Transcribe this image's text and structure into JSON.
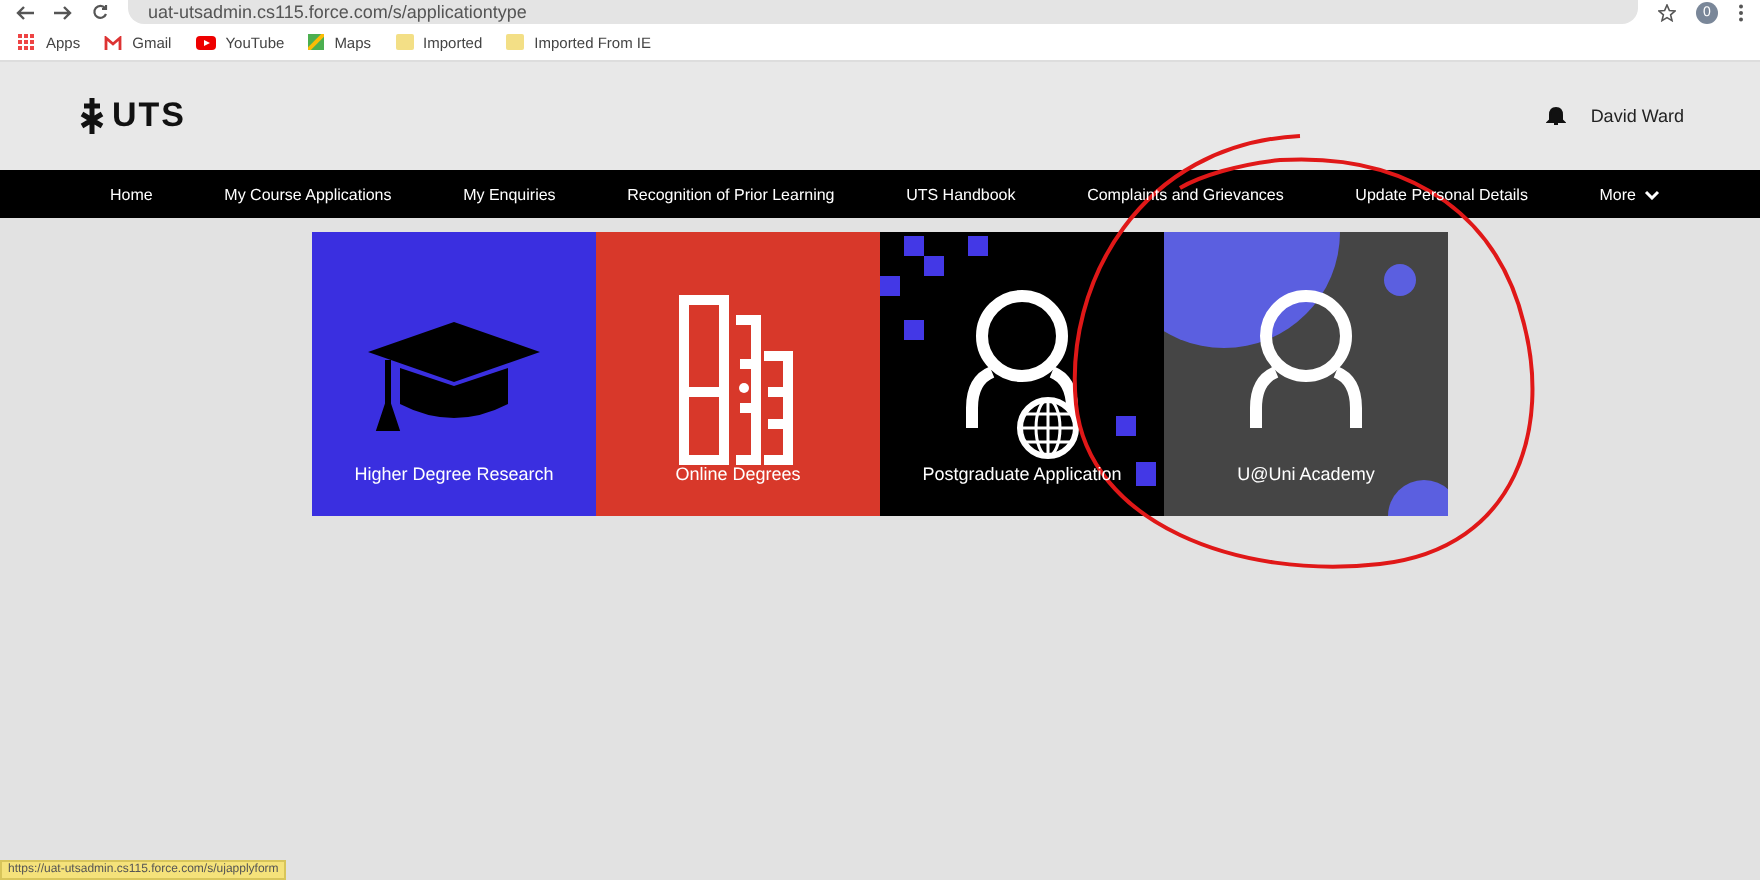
{
  "browser": {
    "url": "uat-utsadmin.cs115.force.com/s/applicationtype",
    "profile": "0",
    "bookmarks": [
      {
        "kind": "apps",
        "label": "Apps"
      },
      {
        "kind": "gmail",
        "label": "Gmail"
      },
      {
        "kind": "youtube",
        "label": "YouTube"
      },
      {
        "kind": "maps",
        "label": "Maps"
      },
      {
        "kind": "folder",
        "label": "Imported"
      },
      {
        "kind": "folder",
        "label": "Imported From IE"
      }
    ]
  },
  "header": {
    "logo": "UTS",
    "user": "David Ward"
  },
  "nav": [
    {
      "label": "Home",
      "dropdown": false
    },
    {
      "label": "My Course Applications",
      "dropdown": false
    },
    {
      "label": "My Enquiries",
      "dropdown": false
    },
    {
      "label": "Recognition of Prior Learning",
      "dropdown": false
    },
    {
      "label": "UTS Handbook",
      "dropdown": false
    },
    {
      "label": "Complaints and Grievances",
      "dropdown": false
    },
    {
      "label": "Update Personal Details",
      "dropdown": false
    },
    {
      "label": "More",
      "dropdown": true
    }
  ],
  "tiles": [
    {
      "kind": "research",
      "label": "Higher Degree Research"
    },
    {
      "kind": "online",
      "label": "Online Degrees"
    },
    {
      "kind": "postgrad",
      "label": "Postgraduate Application"
    },
    {
      "kind": "academy",
      "label": "U@Uni Academy"
    }
  ],
  "status_url": "https://uat-utsadmin.cs115.force.com/s/ujapplyform"
}
